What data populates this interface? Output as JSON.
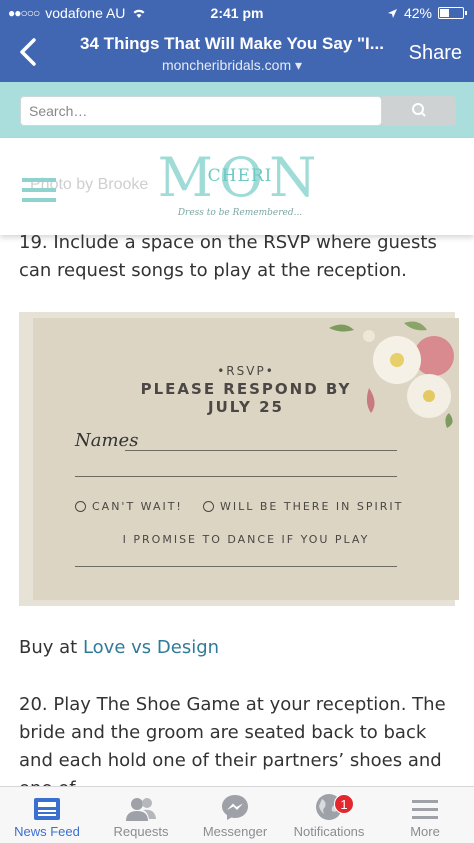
{
  "status_bar": {
    "carrier": "vodafone AU",
    "time": "2:41 pm",
    "battery": "42%",
    "battery_level": 0.42
  },
  "nav": {
    "title": "34 Things That Will Make You Say \"I...",
    "domain": "moncheribridals.com",
    "share_label": "Share"
  },
  "site": {
    "search_placeholder": "Search…",
    "logo_main": "MON",
    "logo_sub": "CHERI",
    "logo_tagline": "Dress to be Remembered...",
    "ghost_text": "Photo by Brooke"
  },
  "article": {
    "para19": "19. Include a space on the RSVP where guests can request songs to play at the reception.",
    "buy_prefix": "Buy at ",
    "buy_link": "Love vs Design",
    "para20": "20. Play The Shoe Game at your reception. The bride and the groom are seated back to back and each hold one of their partners’ shoes and one of"
  },
  "rsvp_card": {
    "heading1": "•RSVP•",
    "heading2": "PLEASE RESPOND BY",
    "heading3": "JULY 25",
    "names_label": "Names",
    "option1": "CAN'T WAIT!",
    "option2": "WILL BE THERE IN SPIRIT",
    "promise": "I PROMISE TO DANCE IF YOU PLAY"
  },
  "tabbar": {
    "items": [
      {
        "label": "News Feed",
        "icon": "news-feed-icon",
        "active": true
      },
      {
        "label": "Requests",
        "icon": "friend-requests-icon"
      },
      {
        "label": "Messenger",
        "icon": "messenger-icon"
      },
      {
        "label": "Notifications",
        "icon": "globe-icon",
        "badge": "1"
      },
      {
        "label": "More",
        "icon": "menu-icon"
      }
    ]
  },
  "colors": {
    "facebook_blue": "#4267b2",
    "site_teal": "#a9dedd",
    "badge_red": "#e3272d",
    "active_tab": "#3b6fd0"
  }
}
